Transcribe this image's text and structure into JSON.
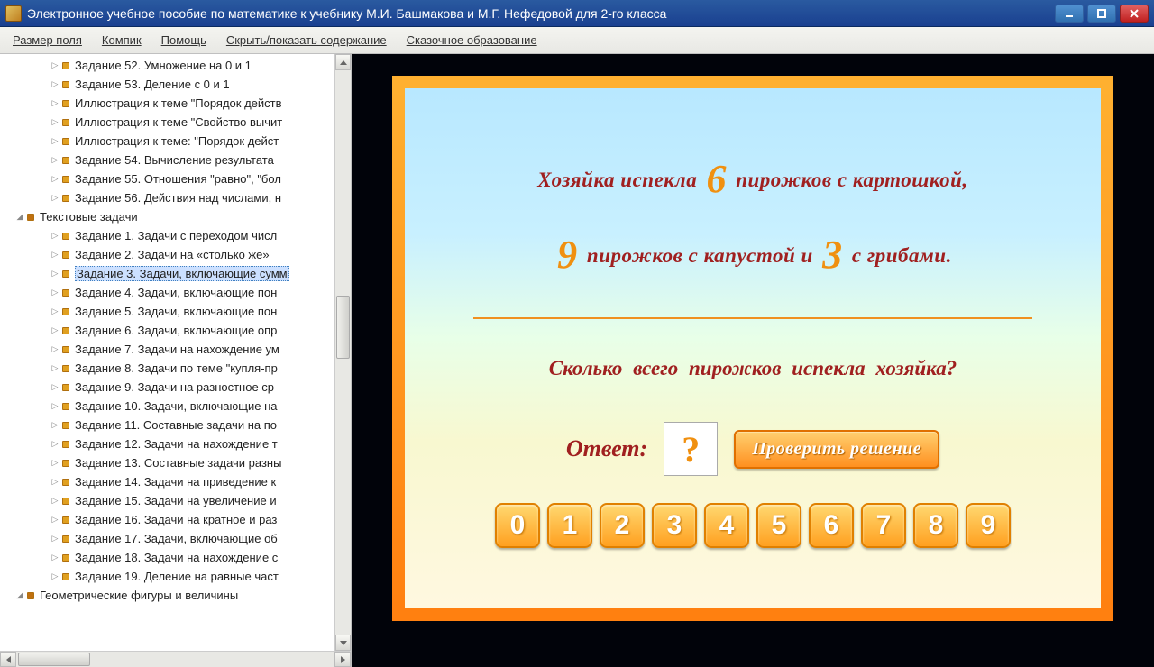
{
  "window": {
    "title": "Электронное учебное пособие по математике к учебнику М.И. Башмакова и М.Г. Нефедовой для 2-го класса"
  },
  "menu": {
    "items": [
      "Размер поля",
      "Компик",
      "Помощь",
      "Скрыть/показать содержание",
      "Сказочное образование"
    ]
  },
  "tree": {
    "selected_index": 12,
    "items": [
      {
        "label": "Задание 52. Умножение на 0 и 1",
        "lvl": 1
      },
      {
        "label": "Задание 53. Деление с 0 и 1",
        "lvl": 1
      },
      {
        "label": "Иллюстрация к теме \"Порядок действ",
        "lvl": 1
      },
      {
        "label": "Иллюстрация к теме \"Свойство вычит",
        "lvl": 1
      },
      {
        "label": "Иллюстрация к теме: \"Порядок дейст",
        "lvl": 1
      },
      {
        "label": "Задание 54. Вычисление результата",
        "lvl": 1
      },
      {
        "label": "Задание 55. Отношения \"равно\", \"бол",
        "lvl": 1
      },
      {
        "label": "Задание 56. Действия над числами, н",
        "lvl": 1
      },
      {
        "label": "Текстовые задачи",
        "lvl": 0,
        "cat": true
      },
      {
        "label": "Задание 1. Задачи с переходом числ",
        "lvl": 1
      },
      {
        "label": "Задание 2. Задачи на «столько же»",
        "lvl": 1
      },
      {
        "label": "Задание 3. Задачи, включающие сумм",
        "lvl": 1,
        "selected": true
      },
      {
        "label": "Задание 4. Задачи, включающие пон",
        "lvl": 1
      },
      {
        "label": "Задание 5. Задачи, включающие пон",
        "lvl": 1
      },
      {
        "label": "Задание 6. Задачи, включающие опр",
        "lvl": 1
      },
      {
        "label": "Задание 7. Задачи на нахождение ум",
        "lvl": 1
      },
      {
        "label": "Задание 8. Задачи по теме \"купля-пр",
        "lvl": 1
      },
      {
        "label": "Задание 9. Задачи на разностное ср",
        "lvl": 1
      },
      {
        "label": "Задание 10. Задачи, включающие на",
        "lvl": 1
      },
      {
        "label": "Задание 11. Составные задачи на по",
        "lvl": 1
      },
      {
        "label": "Задание 12. Задачи на нахождение т",
        "lvl": 1
      },
      {
        "label": "Задание 13. Составные задачи разны",
        "lvl": 1
      },
      {
        "label": "Задание 14. Задачи на приведение к",
        "lvl": 1
      },
      {
        "label": "Задание 15. Задачи на увеличение и",
        "lvl": 1
      },
      {
        "label": "Задание 16. Задачи на кратное и раз",
        "lvl": 1
      },
      {
        "label": "Задание 17. Задачи, включающие об",
        "lvl": 1
      },
      {
        "label": "Задание 18. Задачи на нахождение с",
        "lvl": 1
      },
      {
        "label": "Задание 19. Деление на равные част",
        "lvl": 1
      },
      {
        "label": "Геометрические фигуры и величины",
        "lvl": 0,
        "cat": true
      }
    ]
  },
  "task": {
    "line1_a": "Хозяйка испекла ",
    "n1": "6",
    "line1_b": " пирожков с картошкой,",
    "n2": "9",
    "line2_a": " пирожков с капустой и ",
    "n3": "3",
    "line2_b": " с грибами.",
    "question": "Сколько всего пирожков испекла хозяйка?",
    "answer_label": "Ответ:",
    "answer_placeholder": "?",
    "check_button": "Проверить решение",
    "keys": [
      "0",
      "1",
      "2",
      "3",
      "4",
      "5",
      "6",
      "7",
      "8",
      "9"
    ]
  }
}
